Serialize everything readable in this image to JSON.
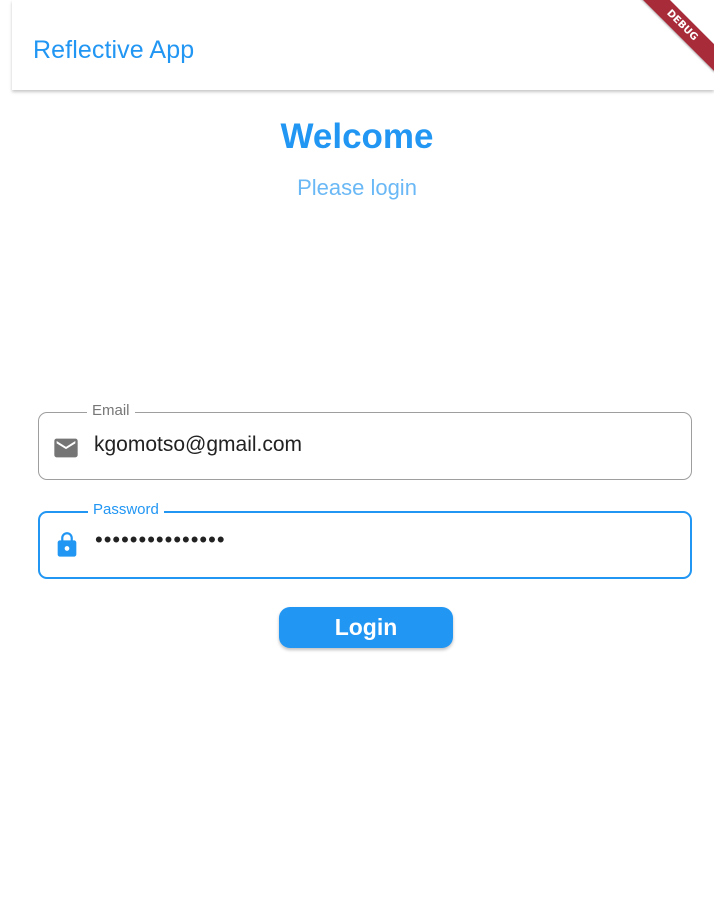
{
  "app_bar": {
    "title": "Reflective App",
    "debug_banner": "DEBUG"
  },
  "header": {
    "welcome": "Welcome",
    "subtitle": "Please login"
  },
  "form": {
    "email": {
      "label": "Email",
      "value": "kgomotso@gmail.com",
      "icon": "mail-icon"
    },
    "password": {
      "label": "Password",
      "value": "•••••••••••••••",
      "icon": "lock-icon"
    },
    "login_label": "Login"
  },
  "colors": {
    "accent": "#2196f3",
    "subtitle": "#6ab8f5",
    "debug_banner": "#a82b3a",
    "field_border": "#9e9e9e"
  }
}
